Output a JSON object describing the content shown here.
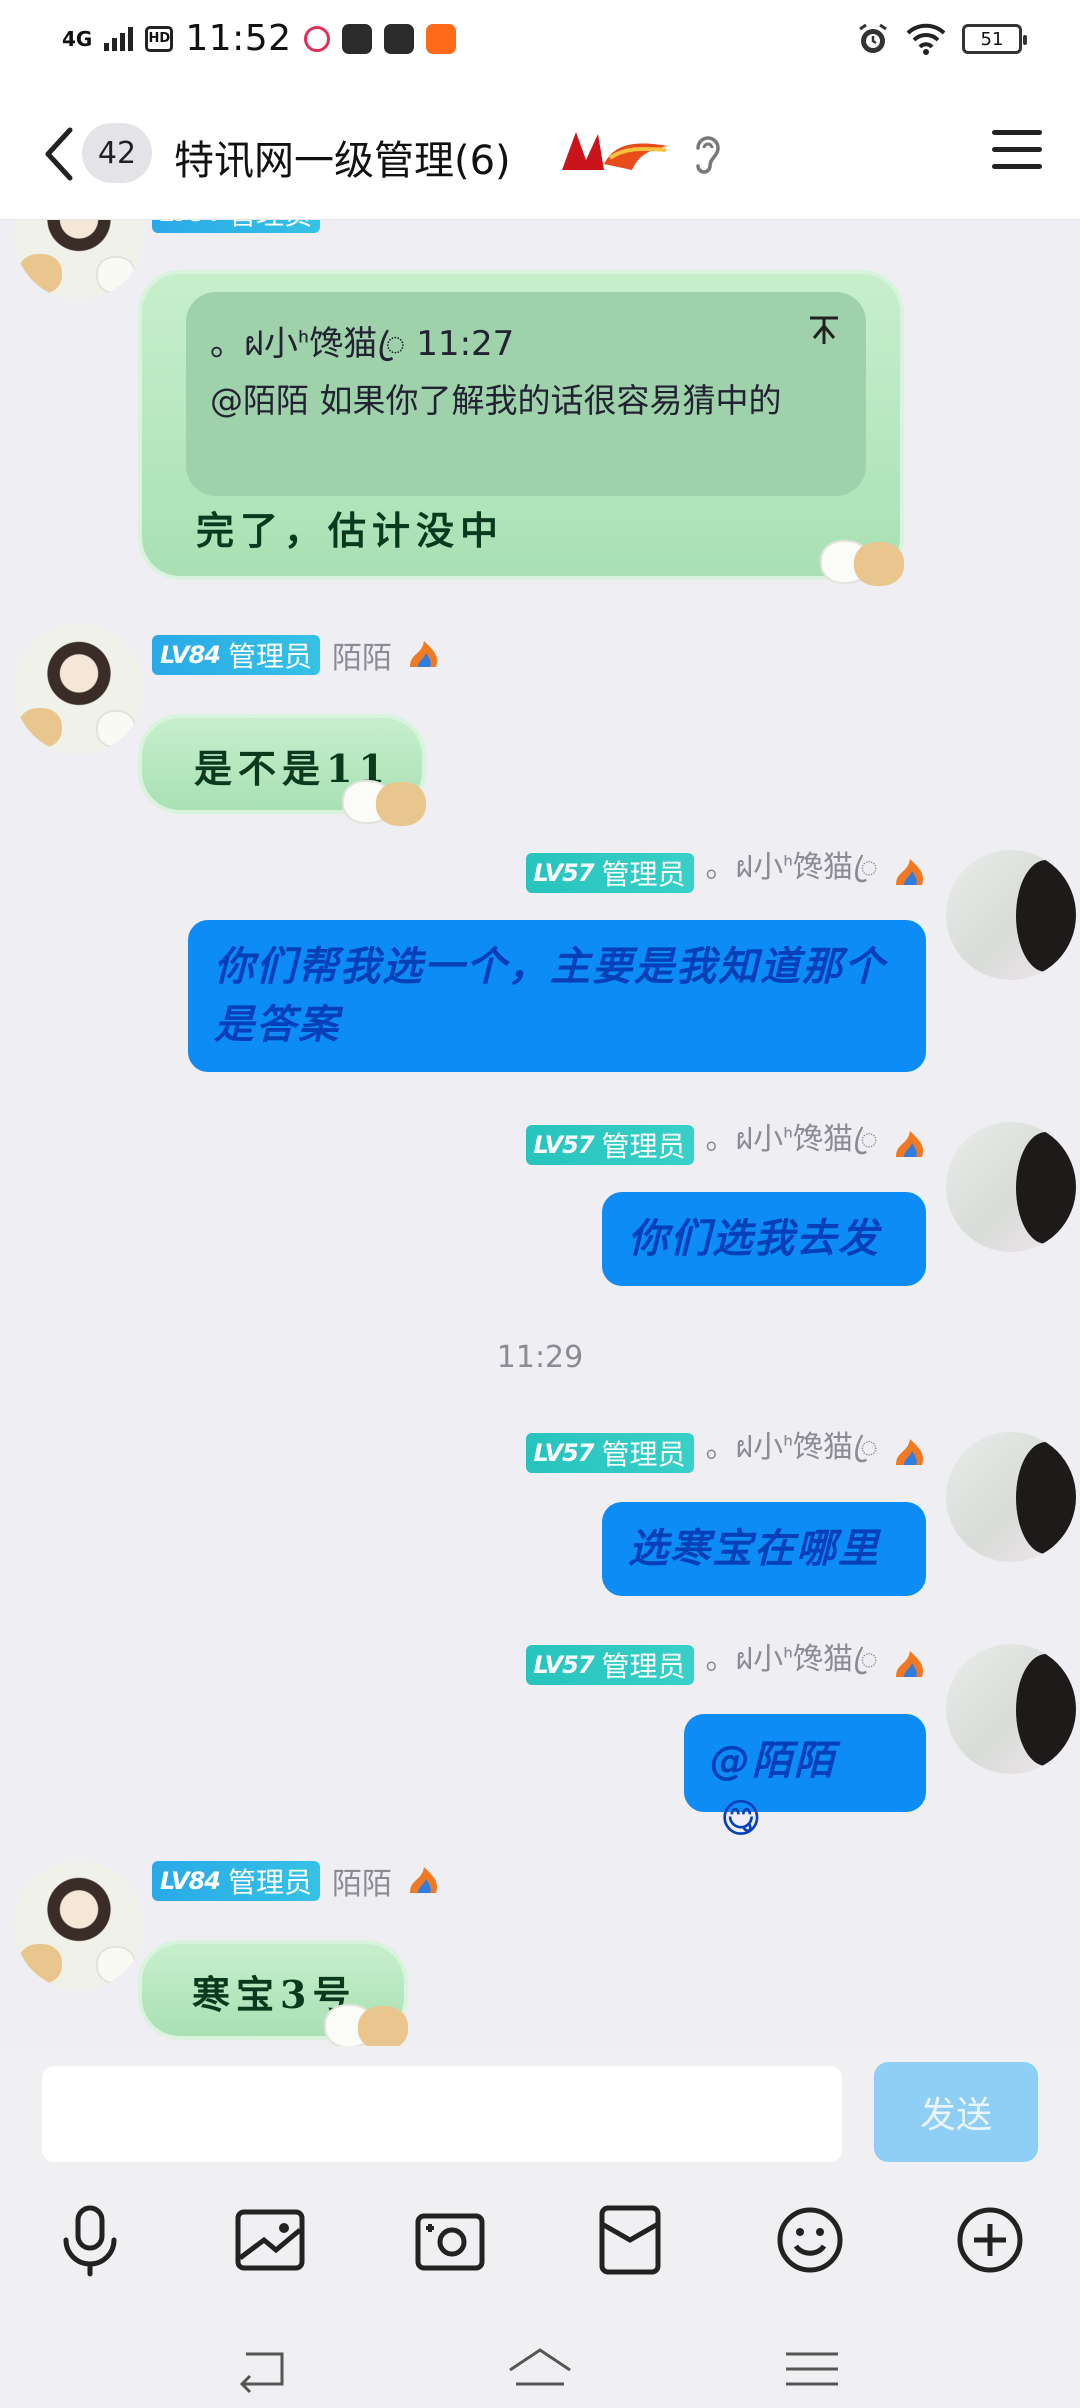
{
  "status_bar": {
    "network": "4G",
    "hd": "HD",
    "time": "11:52",
    "battery": "51"
  },
  "header": {
    "unread_count": "42",
    "title": "特讯网一级管理(6)"
  },
  "chat": {
    "top_partial": {
      "quote_author_time": "。ฝ小ᑋ馋猫ꦿ 11:27",
      "quote_text": "@陌陌 如果你了解我的话很容易猜中的",
      "text": "完了，估计没中"
    },
    "messages": [
      {
        "side": "left",
        "level": "LV84",
        "role": "管理员",
        "nickname": "陌陌",
        "text": "是不是11"
      },
      {
        "side": "right",
        "level": "LV57",
        "role": "管理员",
        "nickname": "。ฝ小ᑋ馋猫ꦿ",
        "text": "你们帮我选一个，主要是我知道那个是答案"
      },
      {
        "side": "right",
        "level": "LV57",
        "role": "管理员",
        "nickname": "。ฝ小ᑋ馋猫ꦿ",
        "text": "你们选我去发"
      },
      {
        "type": "timestamp",
        "text": "11:29"
      },
      {
        "side": "right",
        "level": "LV57",
        "role": "管理员",
        "nickname": "。ฝ小ᑋ馋猫ꦿ",
        "text": "选寒宝在哪里"
      },
      {
        "side": "right",
        "level": "LV57",
        "role": "管理员",
        "nickname": "。ฝ小ᑋ馋猫ꦿ",
        "text": "@陌陌",
        "emoji": "😋"
      },
      {
        "side": "left",
        "level": "LV84",
        "role": "管理员",
        "nickname": "陌陌",
        "text": "寒宝3号"
      }
    ]
  },
  "composer": {
    "input_value": "",
    "send_label": "发送"
  },
  "toolbar_icons": [
    "microphone-icon",
    "image-icon",
    "camera-icon",
    "red-packet-icon",
    "emoji-icon",
    "plus-icon"
  ],
  "nav_icons": [
    "back-nav-icon",
    "home-nav-icon",
    "menu-nav-icon"
  ],
  "colors": {
    "blue_bubble": "#0d8cf5",
    "green_bubble": "#b5e6be",
    "send_button": "#8fcff6",
    "chat_background": "#eeeef3"
  }
}
